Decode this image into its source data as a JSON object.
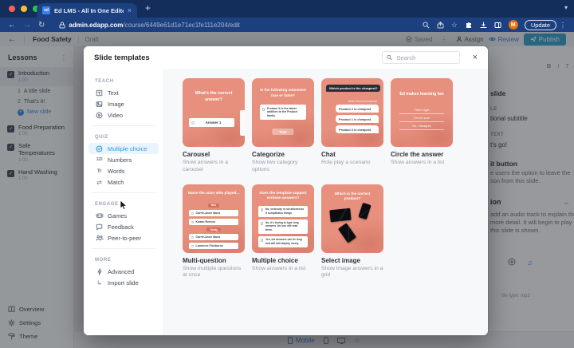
{
  "browser": {
    "tab_title": "Ed LMS - All In One Editor",
    "url_domain": "admin.edapp.com",
    "url_path": "/course/6449e61d1e71ec1fe111e204/edit",
    "update_label": "Update",
    "avatar_initial": "M"
  },
  "icons": {
    "back_glyph": "←",
    "forward_glyph": "→",
    "reload_glyph": "↻",
    "close_glyph": "×",
    "new_tab_glyph": "+",
    "chevron_glyph": "▾",
    "overflow_glyph": "⋮",
    "star_glyph": "☆",
    "check_glyph": "✓",
    "plus_glyph": "+",
    "match_glyph": "⇄",
    "numbers_glyph": "123",
    "words_glyph": "Tr",
    "import_glyph": "↳",
    "music_glyph": "♫",
    "favicon_text": "ed",
    "minus_glyph": "–"
  },
  "header": {
    "course_title": "Food Safety",
    "status": "Draft",
    "saved_label": "Saved",
    "assign_label": "Assign",
    "review_label": "Review",
    "publish_label": "Publish"
  },
  "lessons": {
    "title": "Lessons",
    "items": [
      {
        "name": "Introduction",
        "duration": "1:00"
      },
      {
        "name": "Food Preparation",
        "duration": "1:00"
      },
      {
        "name": "Safe Temperatures",
        "duration": "1:00"
      },
      {
        "name": "Hand Washing",
        "duration": "1:00"
      }
    ],
    "intro_slides": [
      {
        "num": "1",
        "title": "A title slide"
      },
      {
        "num": "2",
        "title": "That's it!"
      }
    ],
    "new_slide_label": "New slide",
    "footer": [
      {
        "label": "Overview"
      },
      {
        "label": "Settings"
      },
      {
        "label": "Theme"
      }
    ]
  },
  "modal": {
    "title": "Slide templates",
    "search_placeholder": "Search",
    "nav": {
      "teach_label": "TEACH",
      "quiz_label": "QUIZ",
      "engage_label": "ENGAGE",
      "more_label": "MORE",
      "teach": [
        {
          "label": "Text"
        },
        {
          "label": "Image"
        },
        {
          "label": "Video"
        }
      ],
      "quiz": [
        {
          "label": "Multiple choice"
        },
        {
          "label": "Numbers"
        },
        {
          "label": "Words"
        },
        {
          "label": "Match"
        }
      ],
      "engage": [
        {
          "label": "Games"
        },
        {
          "label": "Feedback"
        },
        {
          "label": "Peer-to-peer"
        }
      ],
      "more": [
        {
          "label": "Advanced"
        },
        {
          "label": "Import slide"
        }
      ]
    },
    "templates": [
      {
        "name": "Carousel",
        "description": "Show answers in a carousel",
        "preview": {
          "question": "What's the correct answer?",
          "answer": "Answer 1"
        }
      },
      {
        "name": "Categorize",
        "description": "Show two category options",
        "preview": {
          "question": "Is the following statement true or false?",
          "statement": "Product X is the latest addition to the Product family",
          "button": "True"
        }
      },
      {
        "name": "Chat",
        "description": "Role play a scenario",
        "preview": {
          "question": "Which product is the cheapest?",
          "caption": "Select the best response",
          "replies": [
            "Product 2 is cheapest",
            "Product 1 is cheapest",
            "Product 3 is cheapest"
          ]
        }
      },
      {
        "name": "Circle the answer",
        "description": "Show answers in a list",
        "preview": {
          "question": "Ed makes learning fun",
          "options": [
            "That's right",
            "I'm not sure",
            "No, I disagree"
          ]
        }
      },
      {
        "name": "Multi-question",
        "description": "Show multiple questions at once",
        "preview": {
          "question": "Name the actor who played...",
          "group1": "Neo",
          "group1_options": [
            "Carrie-Anne Moss",
            "Keanu Reeves"
          ],
          "group2": "Trinity",
          "group2_options": [
            "Carrie-Anne Moss",
            "Laurence Fishburne"
          ]
        }
      },
      {
        "name": "Multiple choice",
        "description": "Show answers in a list",
        "preview": {
          "question": "Does the template support verbose answers?",
          "options": [
            "No, verbosity is not allowed as it complicates things.",
            "No, it's boring to type long answers. No one will read them.",
            "Yes, the answers can be long and will still display nicely."
          ]
        }
      },
      {
        "name": "Select image",
        "description": "Show image answers in a grid",
        "preview": {
          "question": "Which is the correct product?"
        }
      }
    ]
  },
  "inspector": {
    "format_bold": "B",
    "format_italic": "I",
    "format_text": "T",
    "frag_title": "slide",
    "frag_subtitle_cap": "LE",
    "frag_subtitle": "tional subtitle",
    "frag_button_cap": "TEXT",
    "frag_button_text": "t's go!",
    "frag_exit_title": "it button",
    "frag_exit_line1": "e users the option to leave the",
    "frag_exit_line2": "son from this slide.",
    "frag_narration_title": "ion",
    "frag_narration_line1": "add an audio track to explain this",
    "frag_narration_line2": "more detail. It will begin to play as",
    "frag_narration_line3": "this slide is shown.",
    "frag_file_type": "file type: mp3"
  },
  "bottom_bar": {
    "mobile_label": "Mobile"
  },
  "colors": {
    "chrome_navy": "#1d4180",
    "accent_blue": "#2f9ae2",
    "publish_teal": "#2d9fc9",
    "card_salmon": "#e8907e",
    "avatar_orange": "#e8710a",
    "new_slide_blue": "#2f8fe0"
  }
}
